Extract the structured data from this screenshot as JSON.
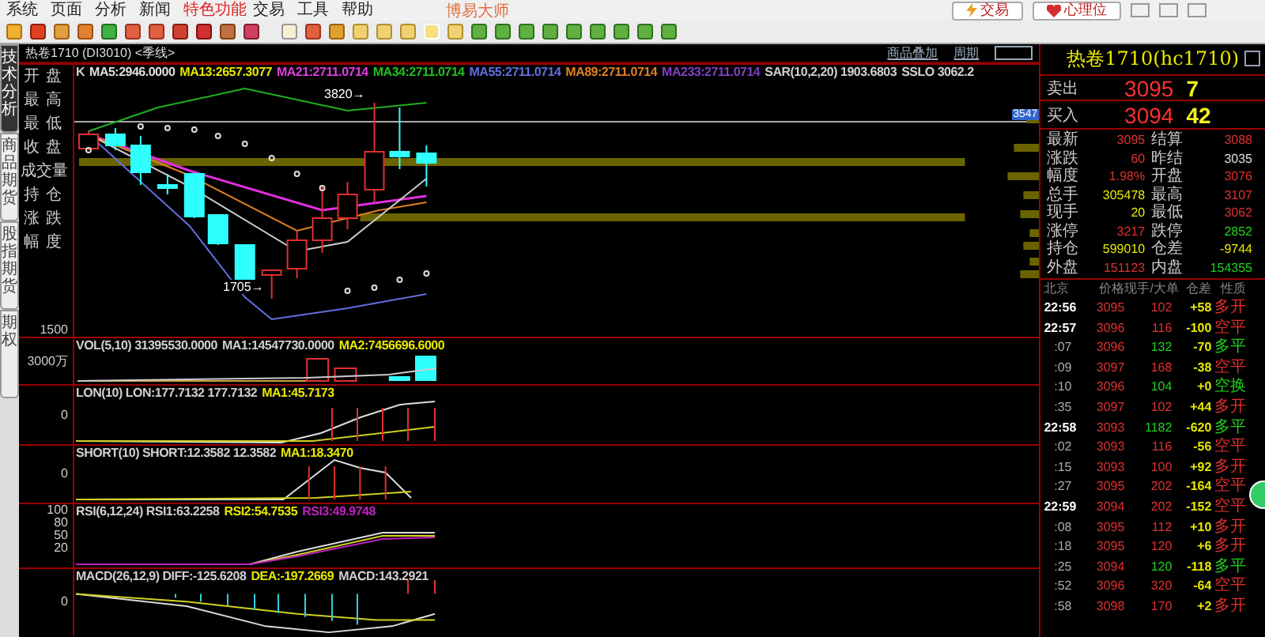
{
  "menu": [
    {
      "label": "系统",
      "selected": false
    },
    {
      "label": "页面",
      "selected": false
    },
    {
      "label": "分析",
      "selected": false
    },
    {
      "label": "新闻",
      "selected": false
    },
    {
      "label": "特色功能",
      "selected": true
    },
    {
      "label": "交易",
      "selected": false
    },
    {
      "label": "工具",
      "selected": false
    },
    {
      "label": "帮助",
      "selected": false
    }
  ],
  "app_title": "博易大师",
  "top_buttons": [
    {
      "kind": "trade",
      "label": "交易"
    },
    {
      "kind": "mind",
      "label": "心理位"
    }
  ],
  "chart_header": {
    "title": "热卷1710 (DI3010) <季线>",
    "links": [
      "商品叠加",
      "周期"
    ]
  },
  "side_tabs": [
    {
      "label": "技术分析",
      "selected": true
    },
    {
      "label": "商品期货",
      "selected": false
    },
    {
      "label": "股指期货",
      "selected": false
    },
    {
      "label": "期权",
      "selected": false
    }
  ],
  "price_pane": {
    "legend": [
      {
        "text": "K",
        "color": "#d0d0d0"
      },
      {
        "text": "MA5:2946.0000",
        "color": "#e0e0e0"
      },
      {
        "text": "MA13:2657.3077",
        "color": "#e8e800"
      },
      {
        "text": "MA21:2711.0714",
        "color": "#e040e0"
      },
      {
        "text": "MA34:2711.0714",
        "color": "#20c020"
      },
      {
        "text": "MA55:2711.0714",
        "color": "#6070e0"
      },
      {
        "text": "MA89:2711.0714",
        "color": "#e08020"
      },
      {
        "text": "MA233:2711.0714",
        "color": "#8040c0"
      },
      {
        "text": "SAR(10,2,20) 1903.6803",
        "color": "#d0d0d0"
      },
      {
        "text": "SSLO 3062.2",
        "color": "#d0d0d0"
      }
    ],
    "field_labels": [
      "开盘",
      "最高",
      "最低",
      "收盘",
      "成交量",
      "持仓",
      "涨跌",
      "幅度"
    ],
    "axis_label": "1500",
    "high_mark": "3820→",
    "low_mark": "1705→",
    "price_tag": "3547"
  },
  "panes": [
    {
      "kind": "volume",
      "legend": [
        {
          "text": "VOL(5,10) 31395530.0000",
          "color": "#d0d0d0"
        },
        {
          "text": "MA1:14547730.0000",
          "color": "#d0d0d0"
        },
        {
          "text": "MA2:7456696.6000",
          "color": "#e8e800"
        }
      ],
      "axis_labels": [
        "3000万"
      ]
    },
    {
      "kind": "lon",
      "legend": [
        {
          "text": "LON(10) LON:177.7132 177.7132",
          "color": "#d0d0d0"
        },
        {
          "text": "MA1:45.7173",
          "color": "#e8e800"
        }
      ],
      "axis_labels": [
        "0"
      ]
    },
    {
      "kind": "short",
      "legend": [
        {
          "text": "SHORT(10) SHORT:12.3582 12.3582",
          "color": "#d0d0d0"
        },
        {
          "text": "MA1:18.3470",
          "color": "#e8e800"
        }
      ],
      "axis_labels": [
        "0"
      ]
    },
    {
      "kind": "rsi",
      "legend": [
        {
          "text": "RSI(6,12,24) RSI1:63.2258",
          "color": "#d0d0d0"
        },
        {
          "text": "RSI2:54.7535",
          "color": "#e8e800"
        },
        {
          "text": "RSI3:49.9748",
          "color": "#c020c0"
        }
      ],
      "axis_labels": [
        "100",
        "80",
        "50",
        "20"
      ]
    },
    {
      "kind": "macd",
      "legend": [
        {
          "text": "MACD(26,12,9) DIFF:-125.6208",
          "color": "#d0d0d0"
        },
        {
          "text": "DEA:-197.2669",
          "color": "#e8e800"
        },
        {
          "text": "MACD:143.2921",
          "color": "#d0d0d0"
        }
      ],
      "axis_labels": [
        "0"
      ]
    }
  ],
  "quote": {
    "title": "热卷1710(hc1710)",
    "sell": {
      "label": "卖出",
      "price": "3095",
      "volume": "7"
    },
    "buy": {
      "label": "买入",
      "price": "3094",
      "volume": "42"
    },
    "stats": [
      {
        "label": "最新",
        "value": "3095",
        "color": "#e03030"
      },
      {
        "label": "结算",
        "value": "3088",
        "color": "#e03030"
      },
      {
        "label": "涨跌",
        "value": "60",
        "color": "#e03030"
      },
      {
        "label": "昨结",
        "value": "3035",
        "color": "#e0e0e0"
      },
      {
        "label": "幅度",
        "value": "1.98%",
        "color": "#e03030"
      },
      {
        "label": "开盘",
        "value": "3076",
        "color": "#e03030"
      },
      {
        "label": "总手",
        "value": "305478",
        "color": "#e8e800"
      },
      {
        "label": "最高",
        "value": "3107",
        "color": "#e03030"
      },
      {
        "label": "现手",
        "value": "20",
        "color": "#e8e800"
      },
      {
        "label": "最低",
        "value": "3062",
        "color": "#e03030"
      },
      {
        "label": "涨停",
        "value": "3217",
        "color": "#e03030"
      },
      {
        "label": "跌停",
        "value": "2852",
        "color": "#20d020"
      },
      {
        "label": "持仓",
        "value": "599010",
        "color": "#e8e800"
      },
      {
        "label": "仓差",
        "value": "-9744",
        "color": "#e8e800"
      },
      {
        "label": "外盘",
        "value": "151123",
        "color": "#e03030"
      },
      {
        "label": "内盘",
        "value": "154355",
        "color": "#20d020"
      }
    ],
    "tick_columns": [
      "北京",
      "价格",
      "现手/大单",
      "仓差",
      "性质"
    ],
    "ticks": [
      {
        "time": "22:56",
        "price": "3095",
        "volume": "102",
        "color": "#e03030",
        "diff": "+58",
        "nature": "多开"
      },
      {
        "time": "22:57",
        "price": "3096",
        "volume": "116",
        "color": "#e03030",
        "diff": "-100",
        "nature": "空平"
      },
      {
        "time": ":07",
        "price": "3096",
        "volume": "132",
        "color": "#20d020",
        "diff": "-70",
        "nature": "多平"
      },
      {
        "time": ":09",
        "price": "3097",
        "volume": "168",
        "color": "#e03030",
        "diff": "-38",
        "nature": "空平"
      },
      {
        "time": ":10",
        "price": "3096",
        "volume": "104",
        "color": "#20d020",
        "diff": "+0",
        "nature": "空换"
      },
      {
        "time": ":35",
        "price": "3097",
        "volume": "102",
        "color": "#e03030",
        "diff": "+44",
        "nature": "多开"
      },
      {
        "time": "22:58",
        "price": "3093",
        "volume": "1182",
        "color": "#20d020",
        "diff": "-620",
        "nature": "多平"
      },
      {
        "time": ":02",
        "price": "3093",
        "volume": "116",
        "color": "#e03030",
        "diff": "-56",
        "nature": "空平"
      },
      {
        "time": ":15",
        "price": "3093",
        "volume": "100",
        "color": "#e03030",
        "diff": "+92",
        "nature": "多开"
      },
      {
        "time": ":27",
        "price": "3095",
        "volume": "202",
        "color": "#e03030",
        "diff": "-164",
        "nature": "空平"
      },
      {
        "time": "22:59",
        "price": "3094",
        "volume": "202",
        "color": "#e03030",
        "diff": "-152",
        "nature": "空平"
      },
      {
        "time": ":08",
        "price": "3095",
        "volume": "112",
        "color": "#e03030",
        "diff": "+10",
        "nature": "多开"
      },
      {
        "time": ":18",
        "price": "3095",
        "volume": "120",
        "color": "#e03030",
        "diff": "+6",
        "nature": "多开"
      },
      {
        "time": ":25",
        "price": "3094",
        "volume": "120",
        "color": "#20d020",
        "diff": "-118",
        "nature": "多平"
      },
      {
        "time": ":52",
        "price": "3096",
        "volume": "320",
        "color": "#e03030",
        "diff": "-64",
        "nature": "空平"
      },
      {
        "time": ":58",
        "price": "3098",
        "volume": "170",
        "color": "#e03030",
        "diff": "+2",
        "nature": "多开"
      }
    ]
  }
}
